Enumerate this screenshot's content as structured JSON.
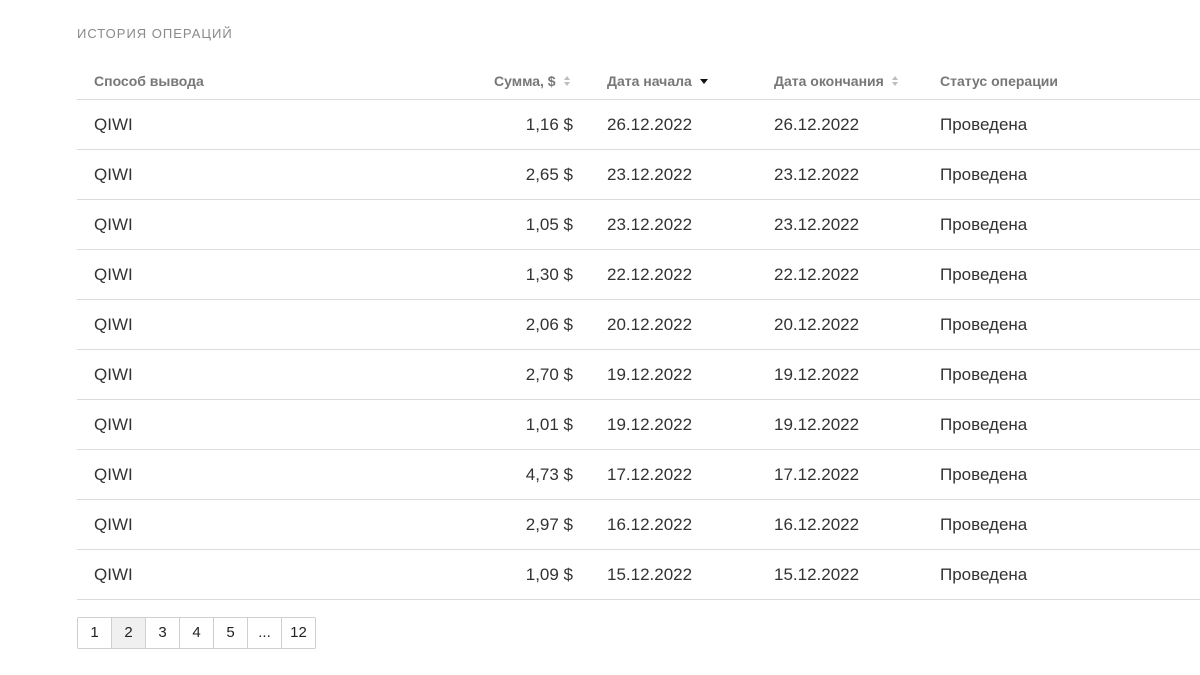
{
  "section_title": "ИСТОРИЯ ОПЕРАЦИЙ",
  "columns": {
    "method": "Способ вывода",
    "amount": "Сумма, $",
    "start": "Дата начала",
    "end": "Дата окончания",
    "status": "Статус операции"
  },
  "rows": [
    {
      "method": "QIWI",
      "amount": "1,16 $",
      "start": "26.12.2022",
      "end": "26.12.2022",
      "status": "Проведена"
    },
    {
      "method": "QIWI",
      "amount": "2,65 $",
      "start": "23.12.2022",
      "end": "23.12.2022",
      "status": "Проведена"
    },
    {
      "method": "QIWI",
      "amount": "1,05 $",
      "start": "23.12.2022",
      "end": "23.12.2022",
      "status": "Проведена"
    },
    {
      "method": "QIWI",
      "amount": "1,30 $",
      "start": "22.12.2022",
      "end": "22.12.2022",
      "status": "Проведена"
    },
    {
      "method": "QIWI",
      "amount": "2,06 $",
      "start": "20.12.2022",
      "end": "20.12.2022",
      "status": "Проведена"
    },
    {
      "method": "QIWI",
      "amount": "2,70 $",
      "start": "19.12.2022",
      "end": "19.12.2022",
      "status": "Проведена"
    },
    {
      "method": "QIWI",
      "amount": "1,01 $",
      "start": "19.12.2022",
      "end": "19.12.2022",
      "status": "Проведена"
    },
    {
      "method": "QIWI",
      "amount": "4,73 $",
      "start": "17.12.2022",
      "end": "17.12.2022",
      "status": "Проведена"
    },
    {
      "method": "QIWI",
      "amount": "2,97 $",
      "start": "16.12.2022",
      "end": "16.12.2022",
      "status": "Проведена"
    },
    {
      "method": "QIWI",
      "amount": "1,09 $",
      "start": "15.12.2022",
      "end": "15.12.2022",
      "status": "Проведена"
    }
  ],
  "pagination": {
    "pages": [
      "1",
      "2",
      "3",
      "4",
      "5",
      "...",
      "12"
    ],
    "current": "2"
  }
}
